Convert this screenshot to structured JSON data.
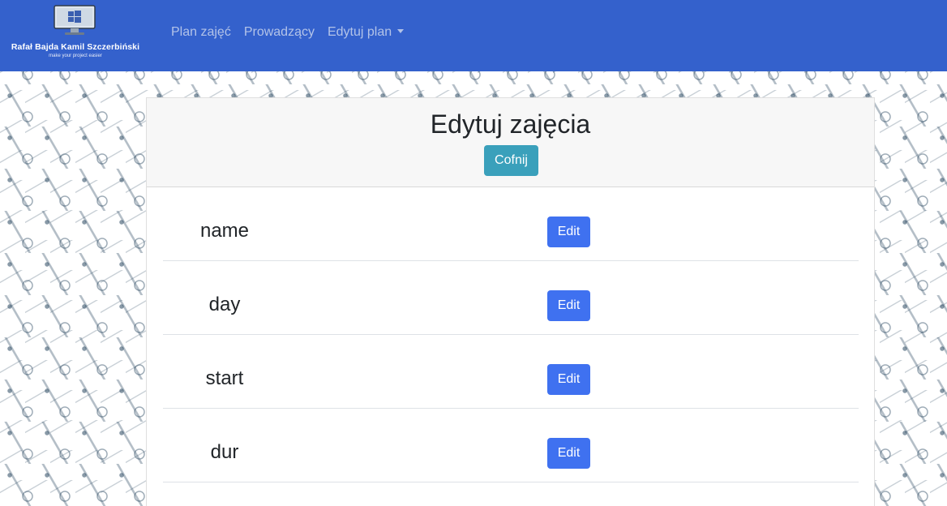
{
  "navbar": {
    "brand_title": "Rafał Bajda Kamil Szczerbiński",
    "brand_tagline": "make your project easier",
    "logo_icon": "computer-monitor-windows-icon",
    "links": [
      {
        "label": "Plan zajęć"
      },
      {
        "label": "Prowadzący"
      },
      {
        "label": "Edytuj plan",
        "has_dropdown": true
      }
    ]
  },
  "card": {
    "title": "Edytuj zajęcia",
    "back_label": "Cofnij",
    "fields": [
      {
        "label": "name",
        "action": "Edit"
      },
      {
        "label": "day",
        "action": "Edit"
      },
      {
        "label": "start",
        "action": "Edit"
      },
      {
        "label": "dur",
        "action": "Edit"
      }
    ]
  },
  "colors": {
    "navbar_bg": "#3461cc",
    "nav_link": "#b3c3e8",
    "back_button": "#3aa0bb",
    "edit_button": "#3f71f0"
  }
}
